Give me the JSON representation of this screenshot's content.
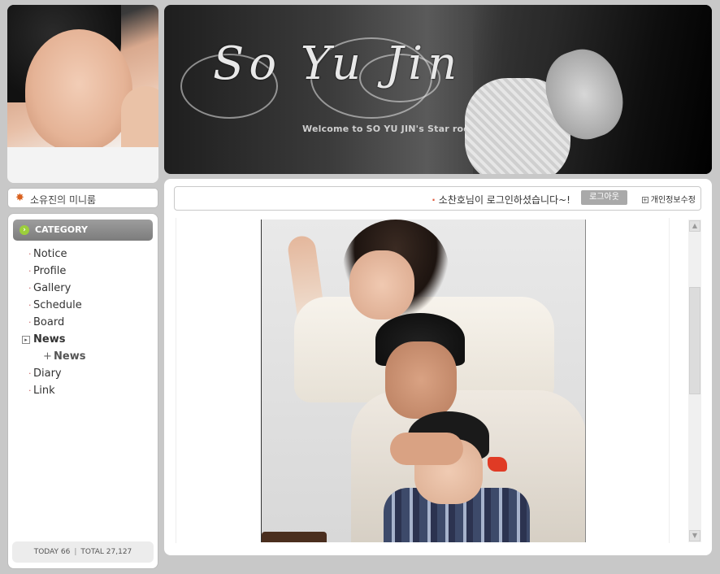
{
  "banner": {
    "title": "So Yu Jin",
    "welcome": "Welcome to SO YU JIN's Star room"
  },
  "miniroom": {
    "label": "소유진의 미니룸"
  },
  "category": {
    "header": "CATEGORY",
    "items": [
      {
        "label": "Notice"
      },
      {
        "label": "Profile"
      },
      {
        "label": "Gallery"
      },
      {
        "label": "Schedule"
      },
      {
        "label": "Board"
      },
      {
        "label": "News"
      },
      {
        "label": "News"
      },
      {
        "label": "Diary"
      },
      {
        "label": "Link"
      }
    ],
    "today": "TODAY 66",
    "total": "TOTAL 27,127"
  },
  "login": {
    "message": "소찬호님이 로그인하셨습니다~!",
    "logout_label": "로그아웃",
    "privacy_label": "개인정보수정"
  },
  "colors": {
    "accent_green": "#9ccf3b",
    "bullet_red": "#c86464",
    "header_gray": "#8c8c8c",
    "background": "#c8c8c8"
  },
  "icons": {
    "miniroom": "maple-leaf-icon",
    "category": "arrow-circle-icon",
    "active_item": "square-bullet-icon",
    "privacy": "plus-box-icon"
  }
}
